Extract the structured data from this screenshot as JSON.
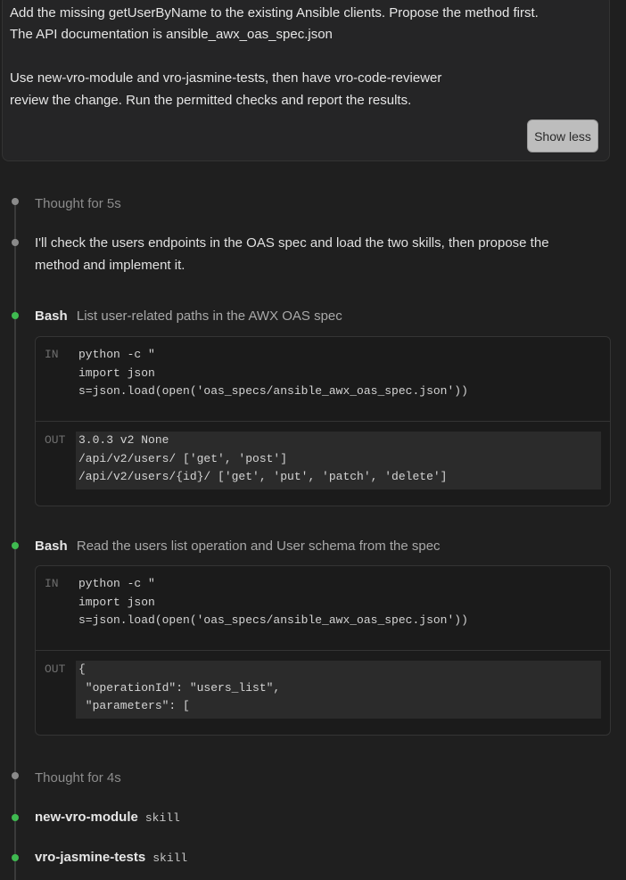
{
  "prompt": {
    "lines": [
      "Add the missing getUserByName to the existing Ansible clients. Propose the method first.",
      "The API documentation is ansible_awx_oas_spec.json",
      "Use new-vro-module and vro-jasmine-tests, then have vro-code-reviewer",
      "review the change. Run the permitted checks and report the results."
    ],
    "show_less_label": "Show less"
  },
  "timeline": {
    "thought1": "Thought for 5s",
    "message": [
      "I'll check the users endpoints in the OAS spec and load the two skills, then propose the",
      "method and implement it."
    ],
    "bash1": {
      "tool": "Bash",
      "description": "List user-related paths in the AWX OAS spec",
      "in_label": "IN",
      "in_lines": [
        "python -c \"",
        "import json",
        "s=json.load(open('oas_specs/ansible_awx_oas_spec.json'))"
      ],
      "out_label": "OUT",
      "out_lines": [
        "3.0.3 v2 None",
        "/api/v2/users/ ['get', 'post']",
        "/api/v2/users/{id}/ ['get', 'put', 'patch', 'delete']"
      ]
    },
    "bash2": {
      "tool": "Bash",
      "description": "Read the users list operation and User schema from the spec",
      "in_label": "IN",
      "in_lines": [
        "python -c \"",
        "import json",
        "s=json.load(open('oas_specs/ansible_awx_oas_spec.json'))"
      ],
      "out_label": "OUT",
      "out_lines": [
        "{",
        " \"operationId\": \"users_list\",",
        " \"parameters\": ["
      ]
    },
    "thought2": "Thought for 4s",
    "skill1": {
      "name": "new-vro-module",
      "tag": "skill"
    },
    "skill2": {
      "name": "vro-jasmine-tests",
      "tag": "skill"
    }
  }
}
